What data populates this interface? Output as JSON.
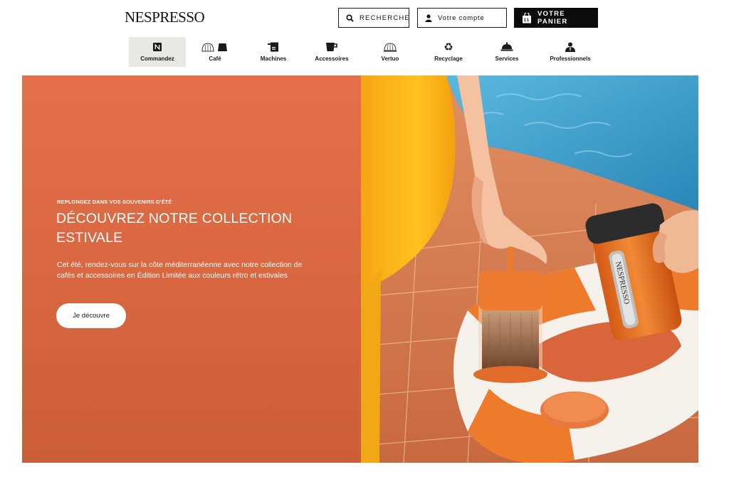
{
  "header": {
    "logo_text": "NESPRESSO",
    "search_label": "RECHERCHE",
    "account_label": "Votre compte",
    "cart_label": "VOTRE PANIER",
    "cart_count": "11"
  },
  "nav": {
    "items": [
      {
        "label": "Commandez",
        "icon": "nespresso-n-icon",
        "active": true
      },
      {
        "label": "Café",
        "icon": "capsules-icon"
      },
      {
        "label": "Machines",
        "icon": "machine-icon"
      },
      {
        "label": "Accessoires",
        "icon": "cup-icon"
      },
      {
        "label": "Vertuo",
        "icon": "vertuo-capsule-icon"
      },
      {
        "label": "Recyclage",
        "icon": "recycle-icon"
      },
      {
        "label": "Services",
        "icon": "service-bell-icon"
      },
      {
        "label": "Professionnels",
        "icon": "professional-icon"
      }
    ]
  },
  "hero": {
    "eyebrow": "REPLONGEZ DANS VOS SOUVENIRS D'ÉTÉ",
    "title_line1": "DÉCOUVREZ NOTRE COLLECTION",
    "title_line2": "ESTIVALE",
    "description_line1": "Cet été, rendez-vous sur la côte méditerranéenne avec notre collection de",
    "description_line2": "cafés et accessoires en Édition Limitée aux couleurs rétro et estivales",
    "cta_label": "Je découvre",
    "mug_print": "NESPRESSO"
  },
  "colors": {
    "hero_orange": "#e06b45",
    "accent_orange": "#ee7a2c",
    "pool_blue": "#3d9cc8",
    "black": "#0c0c0c"
  }
}
